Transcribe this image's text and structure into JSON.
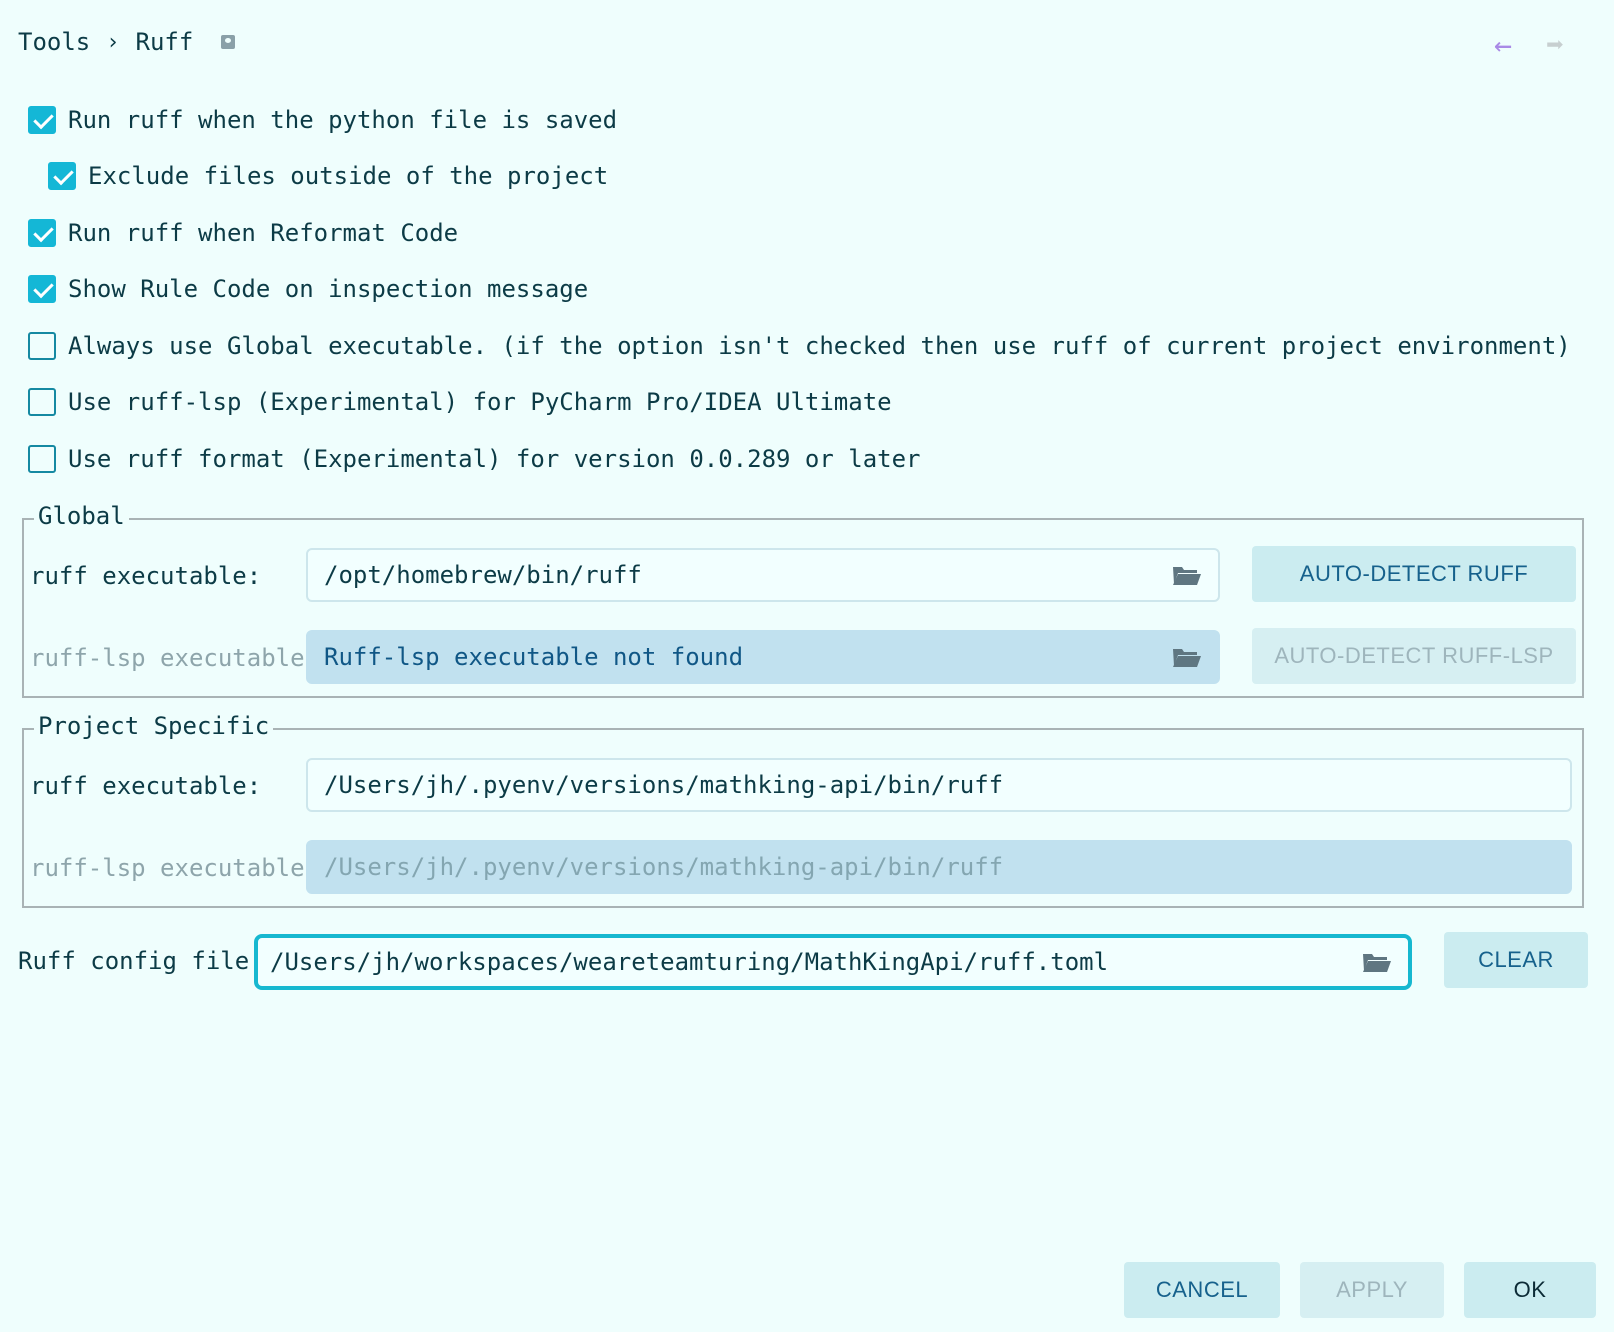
{
  "header": {
    "breadcrumb": [
      "Tools",
      "Ruff"
    ],
    "separator": "›",
    "back_icon": "arrow-left-icon",
    "forward_icon": "arrow-right-icon"
  },
  "options": [
    {
      "label": "Run ruff when the python file is saved",
      "checked": true
    },
    {
      "label": "Exclude files outside of the project",
      "checked": true
    },
    {
      "label": "Run ruff when Reformat Code",
      "checked": true
    },
    {
      "label": "Show Rule Code on inspection message",
      "checked": true
    },
    {
      "label": "Always use Global executable. (if the option isn't checked then use ruff of current project environment)",
      "checked": false
    },
    {
      "label": "Use ruff-lsp (Experimental) for PyCharm Pro/IDEA Ultimate",
      "checked": false
    },
    {
      "label": "Use ruff format (Experimental) for version 0.0.289 or later",
      "checked": false
    }
  ],
  "global": {
    "title": "Global",
    "ruff_label": "ruff executable:",
    "ruff_value": "/opt/homebrew/bin/ruff",
    "lsp_label": "ruff-lsp executable",
    "lsp_value": "Ruff-lsp executable not found",
    "auto_detect_ruff": "AUTO-DETECT RUFF",
    "auto_detect_lsp": "AUTO-DETECT RUFF-LSP"
  },
  "project": {
    "title": "Project Specific",
    "ruff_label": "ruff executable:",
    "ruff_value": "/Users/jh/.pyenv/versions/mathking-api/bin/ruff",
    "lsp_label": "ruff-lsp executable",
    "lsp_value": "/Users/jh/.pyenv/versions/mathking-api/bin/ruff"
  },
  "config": {
    "label": "Ruff config file",
    "value": "/Users/jh/workspaces/weareteamturing/MathKingApi/ruff.toml",
    "clear": "CLEAR"
  },
  "footer": {
    "cancel": "CANCEL",
    "apply": "APPLY",
    "ok": "OK"
  },
  "colors": {
    "background": "#effefd",
    "accent": "#14b7d6",
    "text": "#0c3b46",
    "button": "#cbecf0"
  }
}
